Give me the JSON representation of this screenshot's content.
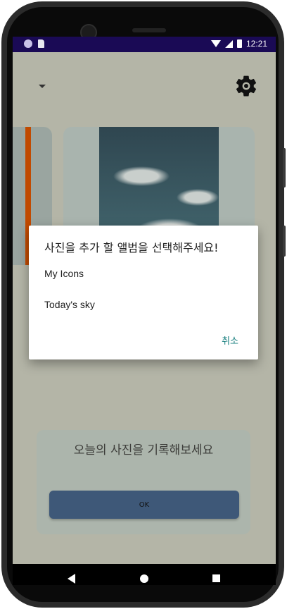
{
  "statusbar": {
    "time": "12:21",
    "icons": [
      "circle-icon",
      "sd-card-icon",
      "wifi-icon",
      "signal-icon",
      "battery-icon"
    ]
  },
  "app": {
    "settings_icon": "gear-icon",
    "dropdown_icon": "dropdown-arrow-icon",
    "bottom_card": {
      "title": "오늘의 사진을 기록해보세요",
      "ok_label": "OK"
    }
  },
  "dialog": {
    "title": "사진을 추가 할 앨범을 선택해주세요!",
    "items": [
      {
        "label": "My Icons"
      },
      {
        "label": "Today's sky"
      }
    ],
    "cancel_label": "취소"
  },
  "colors": {
    "statusbar": "#1a0a55",
    "accent_text": "#1a8080",
    "ok_button": "#3e5878",
    "left_card_accent": "#c14a00"
  }
}
